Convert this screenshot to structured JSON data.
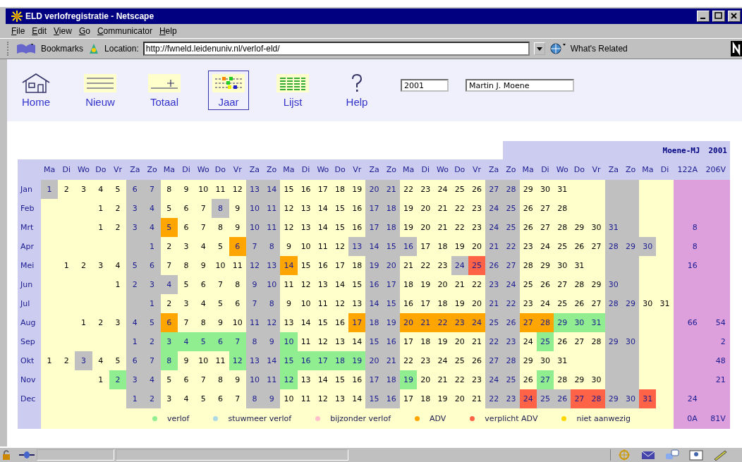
{
  "window": {
    "title": "ELD verlofregistratie - Netscape"
  },
  "menu": [
    "File",
    "Edit",
    "View",
    "Go",
    "Communicator",
    "Help"
  ],
  "location_bar": {
    "bookmarks": "Bookmarks",
    "location_label": "Location:",
    "url": "http://fwneld.leidenuniv.nl/verlof-eld/",
    "related": "What's Related"
  },
  "nav": [
    {
      "label": "Home",
      "kind": "home",
      "selected": false
    },
    {
      "label": "Nieuw",
      "kind": "new",
      "selected": false
    },
    {
      "label": "Totaal",
      "kind": "total",
      "selected": false
    },
    {
      "label": "Jaar",
      "kind": "year",
      "selected": true
    },
    {
      "label": "Lijst",
      "kind": "list",
      "selected": false
    },
    {
      "label": "Help",
      "kind": "help",
      "selected": false
    }
  ],
  "year_field": {
    "value": "2001"
  },
  "name_field": {
    "value": "Martin J. Moene"
  },
  "calendar": {
    "owner": "Moene-MJ",
    "year": "2001",
    "weekdays": [
      "Ma",
      "Di",
      "Wo",
      "Do",
      "Vr",
      "Za",
      "Zo",
      "Ma",
      "Di",
      "Wo",
      "Do",
      "Vr",
      "Za",
      "Zo",
      "Ma",
      "Di",
      "Wo",
      "Do",
      "Vr",
      "Za",
      "Zo",
      "Ma",
      "Di",
      "Wo",
      "Do",
      "Vr",
      "Za",
      "Zo",
      "Ma",
      "Di",
      "Wo",
      "Do",
      "Vr",
      "Za",
      "Zo",
      "Ma",
      "Di"
    ],
    "total_headers": [
      "122A",
      "206V"
    ],
    "months": [
      {
        "name": "Jan",
        "days": [
          {
            "n": "1",
            "kind": "free"
          },
          {
            "n": "2",
            "kind": "work"
          },
          {
            "n": "3",
            "kind": "work"
          },
          {
            "n": "4",
            "kind": "work"
          },
          {
            "n": "5",
            "kind": "work"
          },
          {
            "n": "6",
            "kind": "free"
          },
          {
            "n": "7",
            "kind": "free"
          },
          {
            "n": "8",
            "kind": "work"
          },
          {
            "n": "9",
            "kind": "work"
          },
          {
            "n": "10",
            "kind": "work"
          },
          {
            "n": "11",
            "kind": "work"
          },
          {
            "n": "12",
            "kind": "work"
          },
          {
            "n": "13",
            "kind": "free"
          },
          {
            "n": "14",
            "kind": "free"
          },
          {
            "n": "15",
            "kind": "work"
          },
          {
            "n": "16",
            "kind": "work"
          },
          {
            "n": "17",
            "kind": "work"
          },
          {
            "n": "18",
            "kind": "work"
          },
          {
            "n": "19",
            "kind": "work"
          },
          {
            "n": "20",
            "kind": "free"
          },
          {
            "n": "21",
            "kind": "free"
          },
          {
            "n": "22",
            "kind": "work"
          },
          {
            "n": "23",
            "kind": "work"
          },
          {
            "n": "24",
            "kind": "work"
          },
          {
            "n": "25",
            "kind": "work"
          },
          {
            "n": "26",
            "kind": "work"
          },
          {
            "n": "27",
            "kind": "free"
          },
          {
            "n": "28",
            "kind": "free"
          },
          {
            "n": "29",
            "kind": "work"
          },
          {
            "n": "30",
            "kind": "work"
          },
          {
            "n": "31",
            "kind": "work"
          }
        ]
      },
      {
        "name": "Feb",
        "days": [
          {
            "kind": "blank"
          },
          {
            "kind": "blank"
          },
          {
            "kind": "blank"
          },
          {
            "n": "1",
            "kind": "work"
          },
          {
            "n": "2",
            "kind": "work"
          },
          {
            "n": "3",
            "kind": "free"
          },
          {
            "n": "4",
            "kind": "free"
          },
          {
            "n": "5",
            "kind": "work"
          },
          {
            "n": "6",
            "kind": "work"
          },
          {
            "n": "7",
            "kind": "work"
          },
          {
            "n": "8",
            "kind": "free"
          },
          {
            "n": "9",
            "kind": "work"
          },
          {
            "n": "10",
            "kind": "free"
          },
          {
            "n": "11",
            "kind": "free"
          },
          {
            "n": "12",
            "kind": "work"
          },
          {
            "n": "13",
            "kind": "work"
          },
          {
            "n": "14",
            "kind": "work"
          },
          {
            "n": "15",
            "kind": "work"
          },
          {
            "n": "16",
            "kind": "work"
          },
          {
            "n": "17",
            "kind": "free"
          },
          {
            "n": "18",
            "kind": "free"
          },
          {
            "n": "19",
            "kind": "work"
          },
          {
            "n": "20",
            "kind": "work"
          },
          {
            "n": "21",
            "kind": "work"
          },
          {
            "n": "22",
            "kind": "work"
          },
          {
            "n": "23",
            "kind": "work"
          },
          {
            "n": "24",
            "kind": "free"
          },
          {
            "n": "25",
            "kind": "free"
          },
          {
            "n": "26",
            "kind": "work"
          },
          {
            "n": "27",
            "kind": "work"
          },
          {
            "n": "28",
            "kind": "work"
          }
        ]
      },
      {
        "name": "Mrt",
        "a": "8",
        "days": [
          {
            "kind": "blank"
          },
          {
            "kind": "blank"
          },
          {
            "kind": "blank"
          },
          {
            "n": "1",
            "kind": "work"
          },
          {
            "n": "2",
            "kind": "work"
          },
          {
            "n": "3",
            "kind": "free"
          },
          {
            "n": "4",
            "kind": "free"
          },
          {
            "n": "5",
            "kind": "adv"
          },
          {
            "n": "6",
            "kind": "work"
          },
          {
            "n": "7",
            "kind": "work"
          },
          {
            "n": "8",
            "kind": "work"
          },
          {
            "n": "9",
            "kind": "work"
          },
          {
            "n": "10",
            "kind": "free"
          },
          {
            "n": "11",
            "kind": "free"
          },
          {
            "n": "12",
            "kind": "work"
          },
          {
            "n": "13",
            "kind": "work"
          },
          {
            "n": "14",
            "kind": "work"
          },
          {
            "n": "15",
            "kind": "work"
          },
          {
            "n": "16",
            "kind": "work"
          },
          {
            "n": "17",
            "kind": "free"
          },
          {
            "n": "18",
            "kind": "free"
          },
          {
            "n": "19",
            "kind": "work"
          },
          {
            "n": "20",
            "kind": "work"
          },
          {
            "n": "21",
            "kind": "work"
          },
          {
            "n": "22",
            "kind": "work"
          },
          {
            "n": "23",
            "kind": "work"
          },
          {
            "n": "24",
            "kind": "free"
          },
          {
            "n": "25",
            "kind": "free"
          },
          {
            "n": "26",
            "kind": "work"
          },
          {
            "n": "27",
            "kind": "work"
          },
          {
            "n": "28",
            "kind": "work"
          },
          {
            "n": "29",
            "kind": "work"
          },
          {
            "n": "30",
            "kind": "work"
          },
          {
            "n": "31",
            "kind": "free"
          }
        ]
      },
      {
        "name": "Apr",
        "a": "8",
        "days": [
          {
            "kind": "blank"
          },
          {
            "kind": "blank"
          },
          {
            "kind": "blank"
          },
          {
            "kind": "blank"
          },
          {
            "kind": "blank"
          },
          {
            "kind": "blank"
          },
          {
            "n": "1",
            "kind": "free"
          },
          {
            "n": "2",
            "kind": "work"
          },
          {
            "n": "3",
            "kind": "work"
          },
          {
            "n": "4",
            "kind": "work"
          },
          {
            "n": "5",
            "kind": "work"
          },
          {
            "n": "6",
            "kind": "adv"
          },
          {
            "n": "7",
            "kind": "free"
          },
          {
            "n": "8",
            "kind": "free"
          },
          {
            "n": "9",
            "kind": "work"
          },
          {
            "n": "10",
            "kind": "work"
          },
          {
            "n": "11",
            "kind": "work"
          },
          {
            "n": "12",
            "kind": "work"
          },
          {
            "n": "13",
            "kind": "free"
          },
          {
            "n": "14",
            "kind": "free"
          },
          {
            "n": "15",
            "kind": "free"
          },
          {
            "n": "16",
            "kind": "free"
          },
          {
            "n": "17",
            "kind": "work"
          },
          {
            "n": "18",
            "kind": "work"
          },
          {
            "n": "19",
            "kind": "work"
          },
          {
            "n": "20",
            "kind": "work"
          },
          {
            "n": "21",
            "kind": "free"
          },
          {
            "n": "22",
            "kind": "free"
          },
          {
            "n": "23",
            "kind": "work"
          },
          {
            "n": "24",
            "kind": "work"
          },
          {
            "n": "25",
            "kind": "work"
          },
          {
            "n": "26",
            "kind": "work"
          },
          {
            "n": "27",
            "kind": "work"
          },
          {
            "n": "28",
            "kind": "free"
          },
          {
            "n": "29",
            "kind": "free"
          },
          {
            "n": "30",
            "kind": "free"
          }
        ]
      },
      {
        "name": "Mei",
        "a": "16",
        "days": [
          {
            "kind": "blank"
          },
          {
            "n": "1",
            "kind": "work"
          },
          {
            "n": "2",
            "kind": "work"
          },
          {
            "n": "3",
            "kind": "work"
          },
          {
            "n": "4",
            "kind": "work"
          },
          {
            "n": "5",
            "kind": "free"
          },
          {
            "n": "6",
            "kind": "free"
          },
          {
            "n": "7",
            "kind": "work"
          },
          {
            "n": "8",
            "kind": "work"
          },
          {
            "n": "9",
            "kind": "work"
          },
          {
            "n": "10",
            "kind": "work"
          },
          {
            "n": "11",
            "kind": "work"
          },
          {
            "n": "12",
            "kind": "free"
          },
          {
            "n": "13",
            "kind": "free"
          },
          {
            "n": "14",
            "kind": "adv"
          },
          {
            "n": "15",
            "kind": "work"
          },
          {
            "n": "16",
            "kind": "work"
          },
          {
            "n": "17",
            "kind": "work"
          },
          {
            "n": "18",
            "kind": "work"
          },
          {
            "n": "19",
            "kind": "free"
          },
          {
            "n": "20",
            "kind": "free"
          },
          {
            "n": "21",
            "kind": "work"
          },
          {
            "n": "22",
            "kind": "work"
          },
          {
            "n": "23",
            "kind": "work"
          },
          {
            "n": "24",
            "kind": "free"
          },
          {
            "n": "25",
            "kind": "forced"
          },
          {
            "n": "26",
            "kind": "free"
          },
          {
            "n": "27",
            "kind": "free"
          },
          {
            "n": "28",
            "kind": "work"
          },
          {
            "n": "29",
            "kind": "work"
          },
          {
            "n": "30",
            "kind": "work"
          },
          {
            "n": "31",
            "kind": "work"
          }
        ]
      },
      {
        "name": "Jun",
        "days": [
          {
            "kind": "blank"
          },
          {
            "kind": "blank"
          },
          {
            "kind": "blank"
          },
          {
            "kind": "blank"
          },
          {
            "n": "1",
            "kind": "work"
          },
          {
            "n": "2",
            "kind": "free"
          },
          {
            "n": "3",
            "kind": "free"
          },
          {
            "n": "4",
            "kind": "free"
          },
          {
            "n": "5",
            "kind": "work"
          },
          {
            "n": "6",
            "kind": "work"
          },
          {
            "n": "7",
            "kind": "work"
          },
          {
            "n": "8",
            "kind": "work"
          },
          {
            "n": "9",
            "kind": "free"
          },
          {
            "n": "10",
            "kind": "free"
          },
          {
            "n": "11",
            "kind": "work"
          },
          {
            "n": "12",
            "kind": "work"
          },
          {
            "n": "13",
            "kind": "work"
          },
          {
            "n": "14",
            "kind": "work"
          },
          {
            "n": "15",
            "kind": "work"
          },
          {
            "n": "16",
            "kind": "free"
          },
          {
            "n": "17",
            "kind": "free"
          },
          {
            "n": "18",
            "kind": "work"
          },
          {
            "n": "19",
            "kind": "work"
          },
          {
            "n": "20",
            "kind": "work"
          },
          {
            "n": "21",
            "kind": "work"
          },
          {
            "n": "22",
            "kind": "work"
          },
          {
            "n": "23",
            "kind": "free"
          },
          {
            "n": "24",
            "kind": "free"
          },
          {
            "n": "25",
            "kind": "work"
          },
          {
            "n": "26",
            "kind": "work"
          },
          {
            "n": "27",
            "kind": "work"
          },
          {
            "n": "28",
            "kind": "work"
          },
          {
            "n": "29",
            "kind": "work"
          },
          {
            "n": "30",
            "kind": "free"
          }
        ]
      },
      {
        "name": "Jul",
        "days": [
          {
            "kind": "blank"
          },
          {
            "kind": "blank"
          },
          {
            "kind": "blank"
          },
          {
            "kind": "blank"
          },
          {
            "kind": "blank"
          },
          {
            "kind": "blank"
          },
          {
            "n": "1",
            "kind": "free"
          },
          {
            "n": "2",
            "kind": "work"
          },
          {
            "n": "3",
            "kind": "work"
          },
          {
            "n": "4",
            "kind": "work"
          },
          {
            "n": "5",
            "kind": "work"
          },
          {
            "n": "6",
            "kind": "work"
          },
          {
            "n": "7",
            "kind": "free"
          },
          {
            "n": "8",
            "kind": "free"
          },
          {
            "n": "9",
            "kind": "work"
          },
          {
            "n": "10",
            "kind": "work"
          },
          {
            "n": "11",
            "kind": "work"
          },
          {
            "n": "12",
            "kind": "work"
          },
          {
            "n": "13",
            "kind": "work"
          },
          {
            "n": "14",
            "kind": "free"
          },
          {
            "n": "15",
            "kind": "free"
          },
          {
            "n": "16",
            "kind": "work"
          },
          {
            "n": "17",
            "kind": "work"
          },
          {
            "n": "18",
            "kind": "work"
          },
          {
            "n": "19",
            "kind": "work"
          },
          {
            "n": "20",
            "kind": "work"
          },
          {
            "n": "21",
            "kind": "free"
          },
          {
            "n": "22",
            "kind": "free"
          },
          {
            "n": "23",
            "kind": "work"
          },
          {
            "n": "24",
            "kind": "work"
          },
          {
            "n": "25",
            "kind": "work"
          },
          {
            "n": "26",
            "kind": "work"
          },
          {
            "n": "27",
            "kind": "work"
          },
          {
            "n": "28",
            "kind": "free"
          },
          {
            "n": "29",
            "kind": "free"
          },
          {
            "n": "30",
            "kind": "work"
          },
          {
            "n": "31",
            "kind": "work"
          }
        ]
      },
      {
        "name": "Aug",
        "a": "66",
        "v": "54",
        "days": [
          {
            "kind": "blank"
          },
          {
            "kind": "blank"
          },
          {
            "n": "1",
            "kind": "work"
          },
          {
            "n": "2",
            "kind": "work"
          },
          {
            "n": "3",
            "kind": "work"
          },
          {
            "n": "4",
            "kind": "free"
          },
          {
            "n": "5",
            "kind": "free"
          },
          {
            "n": "6",
            "kind": "adv"
          },
          {
            "n": "7",
            "kind": "work"
          },
          {
            "n": "8",
            "kind": "work"
          },
          {
            "n": "9",
            "kind": "work"
          },
          {
            "n": "10",
            "kind": "work"
          },
          {
            "n": "11",
            "kind": "free"
          },
          {
            "n": "12",
            "kind": "free"
          },
          {
            "n": "13",
            "kind": "work"
          },
          {
            "n": "14",
            "kind": "work"
          },
          {
            "n": "15",
            "kind": "work"
          },
          {
            "n": "16",
            "kind": "work"
          },
          {
            "n": "17",
            "kind": "adv"
          },
          {
            "n": "18",
            "kind": "free"
          },
          {
            "n": "19",
            "kind": "free"
          },
          {
            "n": "20",
            "kind": "adv"
          },
          {
            "n": "21",
            "kind": "adv"
          },
          {
            "n": "22",
            "kind": "adv"
          },
          {
            "n": "23",
            "kind": "adv"
          },
          {
            "n": "24",
            "kind": "adv"
          },
          {
            "n": "25",
            "kind": "free"
          },
          {
            "n": "26",
            "kind": "free"
          },
          {
            "n": "27",
            "kind": "adv"
          },
          {
            "n": "28",
            "kind": "adv"
          },
          {
            "n": "29",
            "kind": "leave"
          },
          {
            "n": "30",
            "kind": "leave"
          },
          {
            "n": "31",
            "kind": "leave"
          }
        ]
      },
      {
        "name": "Sep",
        "v": "2",
        "days": [
          {
            "kind": "blank"
          },
          {
            "kind": "blank"
          },
          {
            "kind": "blank"
          },
          {
            "kind": "blank"
          },
          {
            "kind": "blank"
          },
          {
            "n": "1",
            "kind": "free"
          },
          {
            "n": "2",
            "kind": "free"
          },
          {
            "n": "3",
            "kind": "leave"
          },
          {
            "n": "4",
            "kind": "leave"
          },
          {
            "n": "5",
            "kind": "leave"
          },
          {
            "n": "6",
            "kind": "leave"
          },
          {
            "n": "7",
            "kind": "leave"
          },
          {
            "n": "8",
            "kind": "free"
          },
          {
            "n": "9",
            "kind": "free"
          },
          {
            "n": "10",
            "kind": "leave"
          },
          {
            "n": "11",
            "kind": "work"
          },
          {
            "n": "12",
            "kind": "work"
          },
          {
            "n": "13",
            "kind": "work"
          },
          {
            "n": "14",
            "kind": "work"
          },
          {
            "n": "15",
            "kind": "free"
          },
          {
            "n": "16",
            "kind": "free"
          },
          {
            "n": "17",
            "kind": "work"
          },
          {
            "n": "18",
            "kind": "work"
          },
          {
            "n": "19",
            "kind": "work"
          },
          {
            "n": "20",
            "kind": "work"
          },
          {
            "n": "21",
            "kind": "work"
          },
          {
            "n": "22",
            "kind": "free"
          },
          {
            "n": "23",
            "kind": "free"
          },
          {
            "n": "24",
            "kind": "work"
          },
          {
            "n": "25",
            "kind": "leave"
          },
          {
            "n": "26",
            "kind": "work"
          },
          {
            "n": "27",
            "kind": "work"
          },
          {
            "n": "28",
            "kind": "work"
          },
          {
            "n": "29",
            "kind": "free"
          },
          {
            "n": "30",
            "kind": "free"
          }
        ]
      },
      {
        "name": "Okt",
        "v": "48",
        "days": [
          {
            "n": "1",
            "kind": "work"
          },
          {
            "n": "2",
            "kind": "work"
          },
          {
            "n": "3",
            "kind": "free"
          },
          {
            "n": "4",
            "kind": "work"
          },
          {
            "n": "5",
            "kind": "work"
          },
          {
            "n": "6",
            "kind": "free"
          },
          {
            "n": "7",
            "kind": "free"
          },
          {
            "n": "8",
            "kind": "leave"
          },
          {
            "n": "9",
            "kind": "work"
          },
          {
            "n": "10",
            "kind": "work"
          },
          {
            "n": "11",
            "kind": "work"
          },
          {
            "n": "12",
            "kind": "leave"
          },
          {
            "n": "13",
            "kind": "free"
          },
          {
            "n": "14",
            "kind": "free"
          },
          {
            "n": "15",
            "kind": "leave"
          },
          {
            "n": "16",
            "kind": "leave"
          },
          {
            "n": "17",
            "kind": "leave"
          },
          {
            "n": "18",
            "kind": "leave"
          },
          {
            "n": "19",
            "kind": "leave"
          },
          {
            "n": "20",
            "kind": "free"
          },
          {
            "n": "21",
            "kind": "free"
          },
          {
            "n": "22",
            "kind": "work"
          },
          {
            "n": "23",
            "kind": "work"
          },
          {
            "n": "24",
            "kind": "work"
          },
          {
            "n": "25",
            "kind": "work"
          },
          {
            "n": "26",
            "kind": "work"
          },
          {
            "n": "27",
            "kind": "free"
          },
          {
            "n": "28",
            "kind": "free"
          },
          {
            "n": "29",
            "kind": "work"
          },
          {
            "n": "30",
            "kind": "work"
          },
          {
            "n": "31",
            "kind": "work"
          }
        ]
      },
      {
        "name": "Nov",
        "v": "21",
        "days": [
          {
            "kind": "blank"
          },
          {
            "kind": "blank"
          },
          {
            "kind": "blank"
          },
          {
            "n": "1",
            "kind": "work"
          },
          {
            "n": "2",
            "kind": "leave"
          },
          {
            "n": "3",
            "kind": "free"
          },
          {
            "n": "4",
            "kind": "free"
          },
          {
            "n": "5",
            "kind": "work"
          },
          {
            "n": "6",
            "kind": "work"
          },
          {
            "n": "7",
            "kind": "work"
          },
          {
            "n": "8",
            "kind": "work"
          },
          {
            "n": "9",
            "kind": "work"
          },
          {
            "n": "10",
            "kind": "free"
          },
          {
            "n": "11",
            "kind": "free"
          },
          {
            "n": "12",
            "kind": "leave"
          },
          {
            "n": "13",
            "kind": "work"
          },
          {
            "n": "14",
            "kind": "work"
          },
          {
            "n": "15",
            "kind": "work"
          },
          {
            "n": "16",
            "kind": "work"
          },
          {
            "n": "17",
            "kind": "free"
          },
          {
            "n": "18",
            "kind": "free"
          },
          {
            "n": "19",
            "kind": "leave"
          },
          {
            "n": "20",
            "kind": "work"
          },
          {
            "n": "21",
            "kind": "work"
          },
          {
            "n": "22",
            "kind": "work"
          },
          {
            "n": "23",
            "kind": "work"
          },
          {
            "n": "24",
            "kind": "free"
          },
          {
            "n": "25",
            "kind": "free"
          },
          {
            "n": "26",
            "kind": "work"
          },
          {
            "n": "27",
            "kind": "leave"
          },
          {
            "n": "28",
            "kind": "work"
          },
          {
            "n": "29",
            "kind": "work"
          },
          {
            "n": "30",
            "kind": "work"
          }
        ]
      },
      {
        "name": "Dec",
        "a": "24",
        "days": [
          {
            "kind": "blank"
          },
          {
            "kind": "blank"
          },
          {
            "kind": "blank"
          },
          {
            "kind": "blank"
          },
          {
            "kind": "blank"
          },
          {
            "n": "1",
            "kind": "free"
          },
          {
            "n": "2",
            "kind": "free"
          },
          {
            "n": "3",
            "kind": "work"
          },
          {
            "n": "4",
            "kind": "work"
          },
          {
            "n": "5",
            "kind": "work"
          },
          {
            "n": "6",
            "kind": "work"
          },
          {
            "n": "7",
            "kind": "work"
          },
          {
            "n": "8",
            "kind": "free"
          },
          {
            "n": "9",
            "kind": "free"
          },
          {
            "n": "10",
            "kind": "work"
          },
          {
            "n": "11",
            "kind": "work"
          },
          {
            "n": "12",
            "kind": "work"
          },
          {
            "n": "13",
            "kind": "work"
          },
          {
            "n": "14",
            "kind": "work"
          },
          {
            "n": "15",
            "kind": "free"
          },
          {
            "n": "16",
            "kind": "free"
          },
          {
            "n": "17",
            "kind": "work"
          },
          {
            "n": "18",
            "kind": "work"
          },
          {
            "n": "19",
            "kind": "work"
          },
          {
            "n": "20",
            "kind": "work"
          },
          {
            "n": "21",
            "kind": "work"
          },
          {
            "n": "22",
            "kind": "free"
          },
          {
            "n": "23",
            "kind": "free"
          },
          {
            "n": "24",
            "kind": "forced"
          },
          {
            "n": "25",
            "kind": "free"
          },
          {
            "n": "26",
            "kind": "free"
          },
          {
            "n": "27",
            "kind": "forced"
          },
          {
            "n": "28",
            "kind": "forced"
          },
          {
            "n": "29",
            "kind": "free"
          },
          {
            "n": "30",
            "kind": "free"
          },
          {
            "n": "31",
            "kind": "forced"
          }
        ]
      }
    ],
    "legend": [
      {
        "label": "verlof",
        "color": "#90ee90"
      },
      {
        "label": "stuwmeer verlof",
        "color": "#add8e6"
      },
      {
        "label": "bijzonder verlof",
        "color": "#ffc0cb"
      },
      {
        "label": "ADV",
        "color": "#ffa500"
      },
      {
        "label": "verplicht ADV",
        "color": "#ff6347"
      },
      {
        "label": "niet aanwezig",
        "color": "#ffd700"
      }
    ],
    "totals": [
      "0A",
      "81V"
    ]
  }
}
